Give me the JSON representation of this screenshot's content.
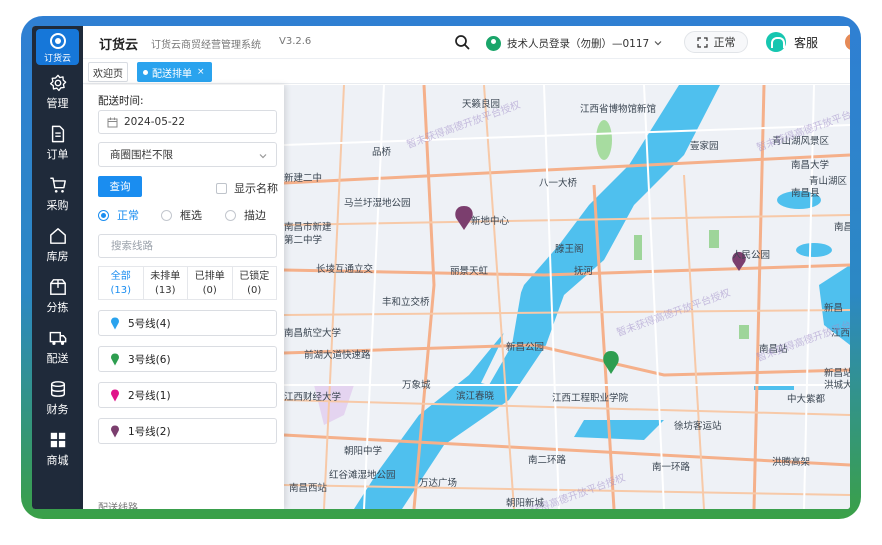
{
  "sidebar": {
    "logo_text": "订货云",
    "items": [
      {
        "label": "管理",
        "icon": "gear-icon"
      },
      {
        "label": "订单",
        "icon": "document-icon"
      },
      {
        "label": "采购",
        "icon": "cart-icon"
      },
      {
        "label": "库房",
        "icon": "house-icon"
      },
      {
        "label": "分拣",
        "icon": "box-icon"
      },
      {
        "label": "配送",
        "icon": "truck-icon"
      },
      {
        "label": "财务",
        "icon": "coins-icon"
      },
      {
        "label": "商城",
        "icon": "grid-icon"
      }
    ]
  },
  "header": {
    "app_name": "订货云",
    "subtitle": "订货云商贸经营管理系统",
    "version": "V3.2.6",
    "user_name": "技术人员登录（勿删）—0117",
    "status_button": "正常",
    "service_label": "客服"
  },
  "tabs": {
    "home": "欢迎页",
    "active": "配送排单",
    "close": "×"
  },
  "panel": {
    "date_label": "配送时间:",
    "date_value": "2024-05-22",
    "select_value": "商圈围栏不限",
    "query_button": "查询",
    "show_name_label": "显示名称",
    "modes": [
      "正常",
      "框选",
      "描边"
    ],
    "route_search_placeholder": "搜索线路",
    "stats": [
      {
        "label": "全部",
        "count": "(13)"
      },
      {
        "label": "未排单",
        "count": "(13)"
      },
      {
        "label": "已排单",
        "count": "(0)"
      },
      {
        "label": "已锁定",
        "count": "(0)"
      }
    ],
    "routes": [
      {
        "label": "5号线(4)",
        "color": "#2aa3ee"
      },
      {
        "label": "3号线(6)",
        "color": "#2e9e50"
      },
      {
        "label": "2号线(1)",
        "color": "#e0148a"
      },
      {
        "label": "1号线(2)",
        "color": "#7b3e6e"
      }
    ],
    "footer_text": "配送线路"
  },
  "map": {
    "labels": [
      "天籁良园",
      "江西省博物馆新馆",
      "壹家园",
      "青山湖风景区",
      "南昌大学",
      "品桥",
      "新建二中",
      "南昌县",
      "青山湖区",
      "马兰圩湿地公园",
      "南昌市新建",
      "新地中心",
      "南昌",
      "第二中学",
      "八一大桥",
      "滕王阁",
      "人民公园",
      "长堎互通立交",
      "丽景天虹",
      "抚河",
      "丰和立交桥",
      "新昌",
      "南昌站",
      "新昌公园",
      "江西",
      "南昌航空大学",
      "万象城",
      "新昌站",
      "洪城大市场",
      "中大紫都",
      "江西财经大学",
      "滨江春晓",
      "江西工程职业学院",
      "徐坊客运站",
      "红谷滩湿地公园",
      "万达广场",
      "南二环路",
      "洪腾高架",
      "前湖大道快速路",
      "南一环路",
      "朝阳中学",
      "南昌西站",
      "朝阳新城"
    ],
    "watermarks": [
      "暂未获得高德开放平台授权",
      "暂未获得高德开放平台授权",
      "暂未获得高德开放平台授权",
      "暂未获得高德开放平台授权",
      "暂未获得高德开放平台授权"
    ],
    "pins": [
      {
        "color": "#7b3e6e"
      },
      {
        "color": "#7b3e6e"
      },
      {
        "color": "#2e9e50"
      }
    ]
  }
}
